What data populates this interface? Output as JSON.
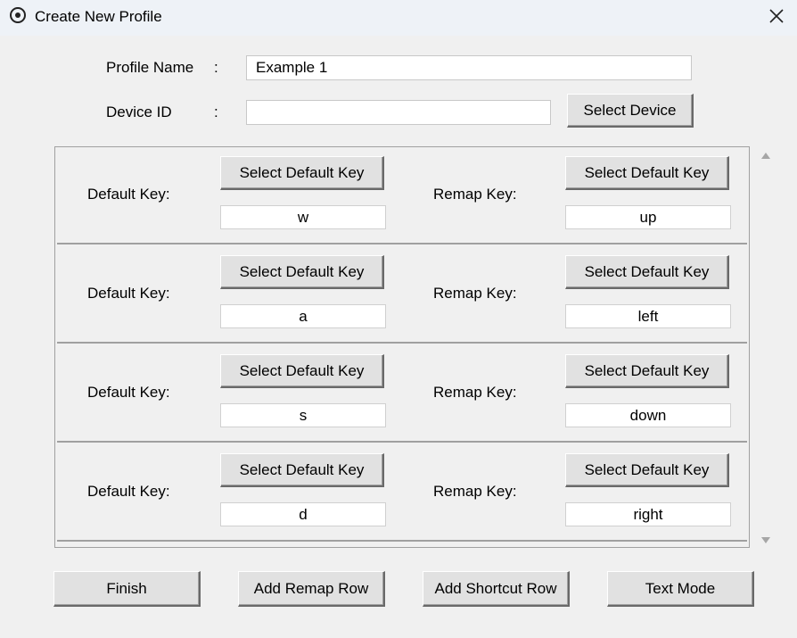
{
  "window": {
    "title": "Create New Profile"
  },
  "form": {
    "profile_name_label": "Profile Name",
    "profile_name_colon": ":",
    "profile_name_value": "Example 1",
    "device_id_label": "Device ID",
    "device_id_colon": ":",
    "device_id_value": "",
    "select_device_label": "Select Device"
  },
  "rows": [
    {
      "default_label": "Default Key:",
      "default_button": "Select Default Key",
      "default_value": "w",
      "remap_label": "Remap Key:",
      "remap_button": "Select Default Key",
      "remap_value": "up"
    },
    {
      "default_label": "Default Key:",
      "default_button": "Select Default Key",
      "default_value": "a",
      "remap_label": "Remap Key:",
      "remap_button": "Select Default Key",
      "remap_value": "left"
    },
    {
      "default_label": "Default Key:",
      "default_button": "Select Default Key",
      "default_value": "s",
      "remap_label": "Remap Key:",
      "remap_button": "Select Default Key",
      "remap_value": "down"
    },
    {
      "default_label": "Default Key:",
      "default_button": "Select Default Key",
      "default_value": "d",
      "remap_label": "Remap Key:",
      "remap_button": "Select Default Key",
      "remap_value": "right"
    }
  ],
  "footer": {
    "finish_label": "Finish",
    "add_remap_row_label": "Add Remap Row",
    "add_shortcut_row_label": "Add Shortcut Row",
    "text_mode_label": "Text Mode"
  },
  "icons": {
    "app": "app-circle-icon",
    "close": "close-icon",
    "scroll_up": "scroll-up-arrow-icon",
    "scroll_down": "scroll-down-arrow-icon"
  }
}
